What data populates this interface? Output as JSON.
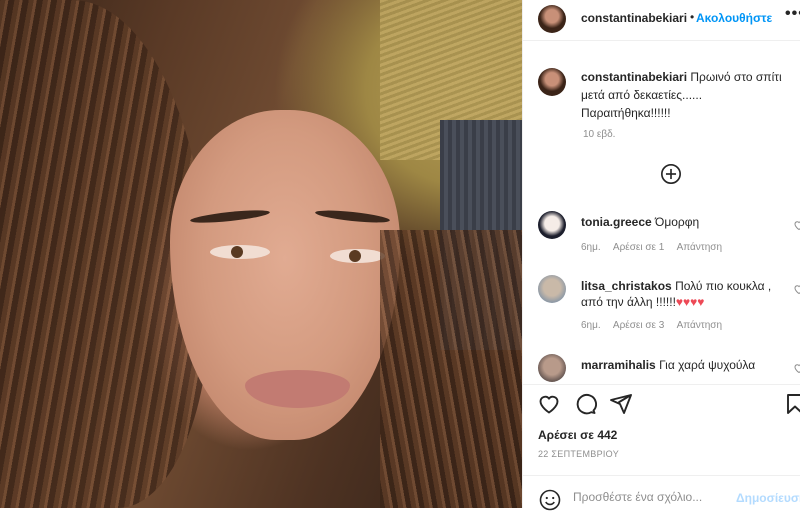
{
  "post": {
    "username": "constantinabekiari",
    "separator": "•",
    "follow_label": "Ακολουθήστε",
    "more_label": "•••"
  },
  "caption": {
    "username": "constantinabekiari",
    "text": "Πρωινό στο σπίτι μετά από δεκαετίες......\nΠαραιτήθηκα!!!!!!",
    "time": "10 εβδ."
  },
  "comments": [
    {
      "username": "tonia.greece",
      "text": "Όμορφη",
      "time": "6ημ.",
      "likes": "Αρέσει σε 1",
      "reply": "Απάντηση"
    },
    {
      "username": "litsa_christakos",
      "text": "Πολύ πιο κουκλα , από την άλλη !!!!!!",
      "hearts": "♥♥♥♥",
      "time": "6ημ.",
      "likes": "Αρέσει σε 3",
      "reply": "Απάντηση"
    },
    {
      "username": "marramihalis",
      "text": "Για χαρά ψυχούλα"
    }
  ],
  "actions": {
    "likes": "Αρέσει σε 442",
    "date": "22 ΣΕΠΤΕΜΒΡΙΟΥ"
  },
  "add_comment": {
    "placeholder": "Προσθέστε ένα σχόλιο...",
    "post_label": "Δημοσίευση"
  },
  "icons": [
    "add-circle-icon",
    "heart-icon",
    "comment-icon",
    "share-icon",
    "bookmark-icon",
    "emoji-icon"
  ],
  "colors": {
    "link_blue": "#0095f6",
    "heart_red": "#ed4956",
    "post_disabled": "#b3dbff"
  }
}
